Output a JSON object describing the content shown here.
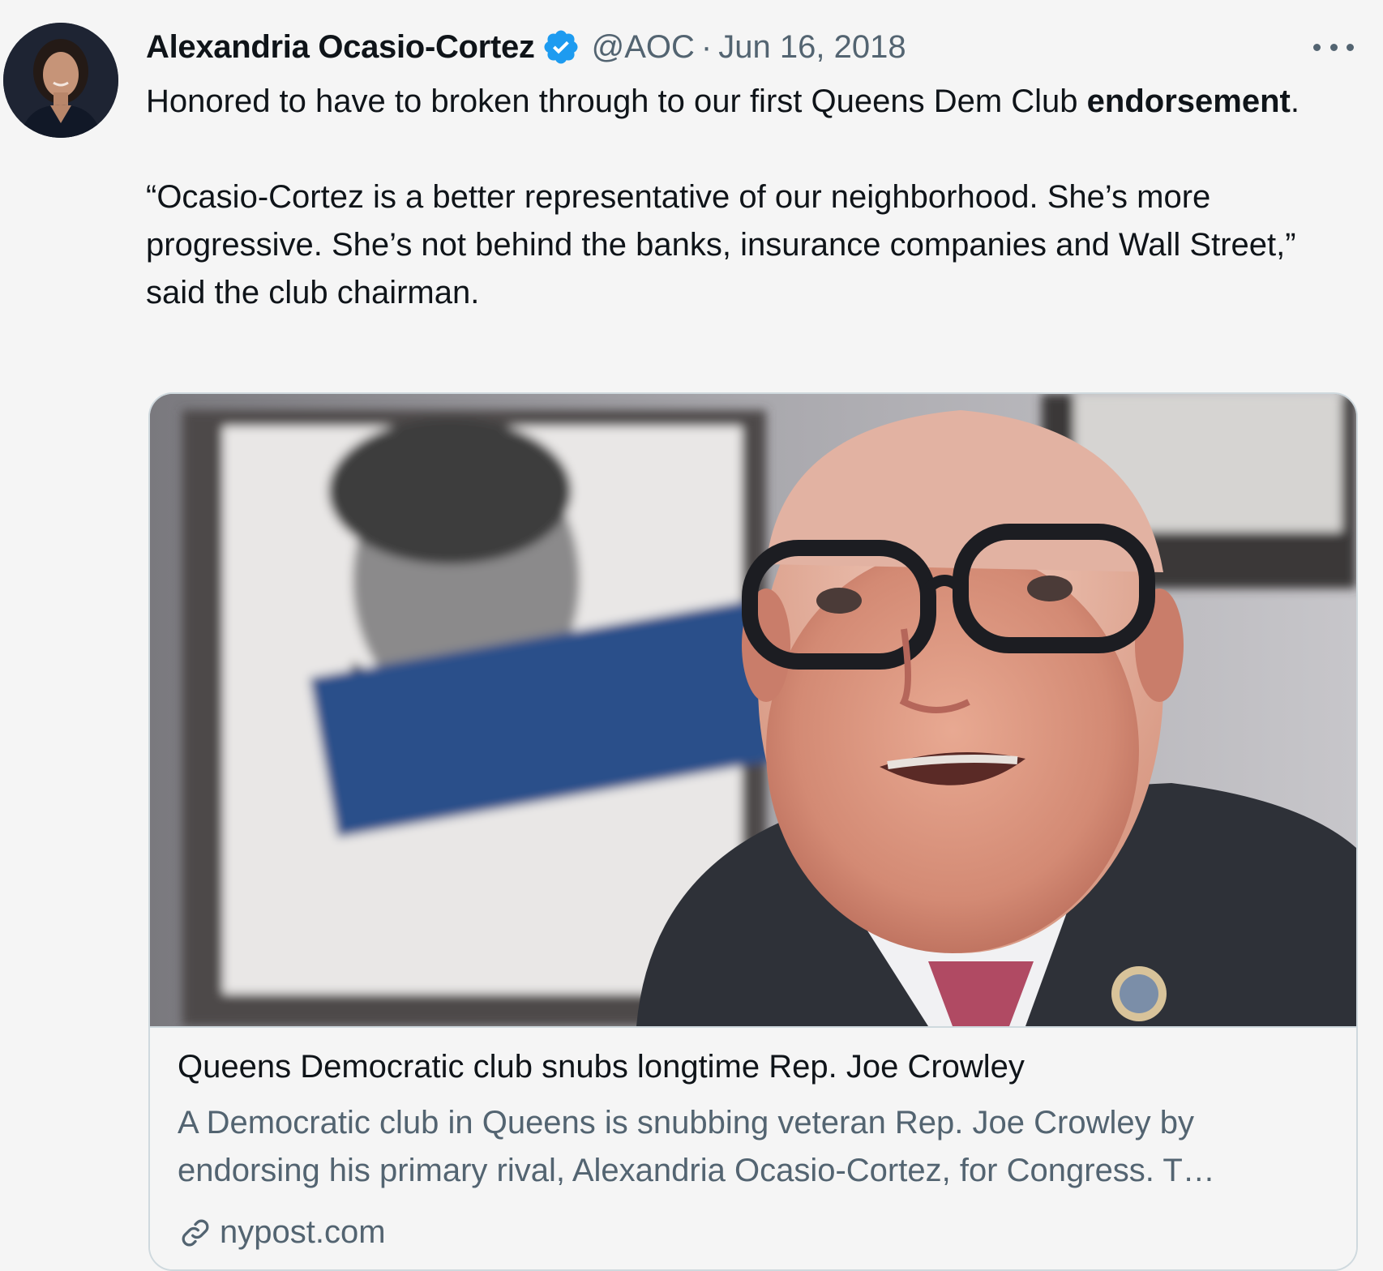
{
  "tweet": {
    "author_name": "Alexandria Ocasio-Cortez",
    "handle": "@AOC",
    "separator": "·",
    "date": "Jun 16, 2018",
    "text_line1_plain": "Honored to have to broken through to our first Queens Dem Club ",
    "text_line1_bold": "endorsement",
    "text_line1_end": ".",
    "quote": "“Ocasio-Cortez is a better representative of our neighborhood. She’s more progressive. She’s not behind the banks, insurance companies and Wall Street,” said the club chairman."
  },
  "card": {
    "title": "Queens Democratic club snubs longtime Rep. Joe Crowley",
    "description": "A Democratic club in Queens is snubbing veteran Rep. Joe Crowley by endorsing his primary rival, Alexandria Ocasio-Cortez, for Congress. T…",
    "domain": "nypost.com"
  },
  "icons": {
    "verified": "verified-badge-icon",
    "more": "more-options-icon",
    "link": "link-icon"
  },
  "colors": {
    "verified": "#1d9bf0",
    "secondary_text": "#536471",
    "primary_text": "#0f1419",
    "border": "#cfd9de"
  }
}
